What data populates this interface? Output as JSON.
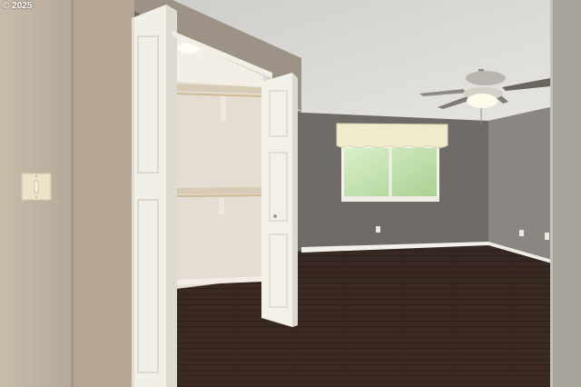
{
  "watermark": {
    "text": "© 2025"
  },
  "colors": {
    "left_wall": "#c7b9a8",
    "right_wall": "#8a8681",
    "back_wall": "#6f6b67",
    "ceiling": "#d9d8d5",
    "floor": "#3a2a22",
    "door": "#f2efe8",
    "closet_interior": "#e8e2d8",
    "trim": "#f4f2ed"
  },
  "icons": {
    "switch": "light-switch-plate",
    "fan": "ceiling-fan",
    "outlet": "wall-outlet"
  }
}
